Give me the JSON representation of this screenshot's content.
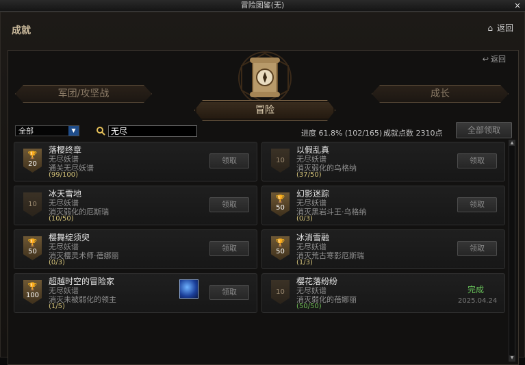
{
  "window": {
    "title": "冒险图鉴(无)",
    "close": "×"
  },
  "header": {
    "title": "成就",
    "home_icon": "home-icon",
    "return_label": "返回"
  },
  "panel": {
    "return_label": "返回"
  },
  "tabs": {
    "left": "军团/攻坚战",
    "center": "冒险",
    "right": "成长"
  },
  "filter": {
    "selected": "全部",
    "search_value": "无尽"
  },
  "stats": {
    "progress": "进度  61.8% (102/165)",
    "points": "成就点数  2310点",
    "claim_all": "全部领取"
  },
  "achievements": [
    {
      "name": "落樱终章",
      "category": "无尽妖谱",
      "desc": "通关无尽妖谱",
      "progress": "(99/100)",
      "points": "20",
      "button": "领取",
      "trophy": true
    },
    {
      "name": "以假乱真",
      "category": "无尽妖谱",
      "desc": "消灭弱化的乌格纳",
      "progress": "(37/50)",
      "points": "10",
      "button": "领取",
      "trophy": false
    },
    {
      "name": "冰天雪地",
      "category": "无尽妖谱",
      "desc": "消灭弱化的厄斯瑞",
      "progress": "(10/50)",
      "points": "10",
      "button": "领取",
      "trophy": false
    },
    {
      "name": "幻影迷踪",
      "category": "无尽妖谱",
      "desc": "消灭黑岩斗王·乌格纳",
      "progress": "(0/3)",
      "points": "50",
      "button": "领取",
      "trophy": true
    },
    {
      "name": "樱舞绽须臾",
      "category": "无尽妖谱",
      "desc": "消灭樱灵术师·蓓娜丽",
      "progress": "(0/3)",
      "points": "50",
      "button": "领取",
      "trophy": true
    },
    {
      "name": "冰消雪融",
      "category": "无尽妖谱",
      "desc": "消灭荒古寒影厄斯瑞",
      "progress": "(1/3)",
      "points": "50",
      "button": "领取",
      "trophy": true
    },
    {
      "name": "超越时空的冒险家",
      "category": "无尽妖谱",
      "desc": "消灭未被弱化的领主",
      "progress": "(1/5)",
      "points": "100",
      "button": "领取",
      "trophy": true
    },
    {
      "name": "樱花落纷纷",
      "category": "无尽妖谱",
      "desc": "消灭弱化的蓓娜丽",
      "progress": "(50/50)",
      "points": "10",
      "status": "完成",
      "date": "2025.04.24",
      "trophy": false
    }
  ]
}
